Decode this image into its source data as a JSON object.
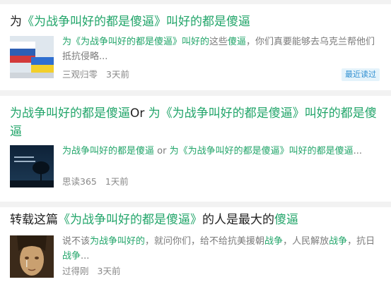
{
  "items": [
    {
      "title": [
        {
          "t": "为",
          "hl": false
        },
        {
          "t": "《为战争叫好的都是傻逼》叫好的都是傻逼",
          "hl": true
        }
      ],
      "snippet": [
        {
          "t": "为《为战争叫好的都是傻逼》叫好的",
          "hl": true
        },
        {
          "t": "这些",
          "hl": false
        },
        {
          "t": "傻逼",
          "hl": true
        },
        {
          "t": "，你们真要能够去乌克兰帮他们抵抗侵略...",
          "hl": false
        }
      ],
      "author": "三观归零",
      "time": "3天前",
      "badge": "最近读过",
      "thumb_icon": "russia-ukraine-flags-image"
    },
    {
      "title": [
        {
          "t": "为战争叫好的都是傻逼",
          "hl": true
        },
        {
          "t": "Or ",
          "hl": false
        },
        {
          "t": "为《为战争叫好的都是傻逼》叫好的都是傻逼",
          "hl": true
        }
      ],
      "snippet": [
        {
          "t": "为战争叫好的都是傻逼",
          "hl": true
        },
        {
          "t": " or ",
          "hl": false
        },
        {
          "t": "为《为战争叫好的都是傻逼》叫好的都是傻逼",
          "hl": true
        },
        {
          "t": "...",
          "hl": false
        }
      ],
      "author": "思读365",
      "time": "1天前",
      "thumb_icon": "night-tree-image"
    },
    {
      "title": [
        {
          "t": "转载这篇",
          "hl": false
        },
        {
          "t": "《为战争叫好的都是傻逼》",
          "hl": true
        },
        {
          "t": "的人是最大的",
          "hl": false
        },
        {
          "t": "傻逼",
          "hl": true
        }
      ],
      "snippet": [
        {
          "t": "说不该",
          "hl": false
        },
        {
          "t": "为战争叫好的",
          "hl": true
        },
        {
          "t": "，就问你们，给不给抗美援朝",
          "hl": false
        },
        {
          "t": "战争",
          "hl": true
        },
        {
          "t": "，人民解放",
          "hl": false
        },
        {
          "t": "战争",
          "hl": true
        },
        {
          "t": "，抗日",
          "hl": false
        },
        {
          "t": "战争",
          "hl": true
        },
        {
          "t": "...",
          "hl": false
        }
      ],
      "author": "过得刚",
      "time": "3天前",
      "thumb_icon": "crying-woman-image"
    }
  ],
  "colors": {
    "highlight": "#22a56a",
    "badge_bg": "#e4f3fb",
    "badge_text": "#2f8fd1"
  }
}
